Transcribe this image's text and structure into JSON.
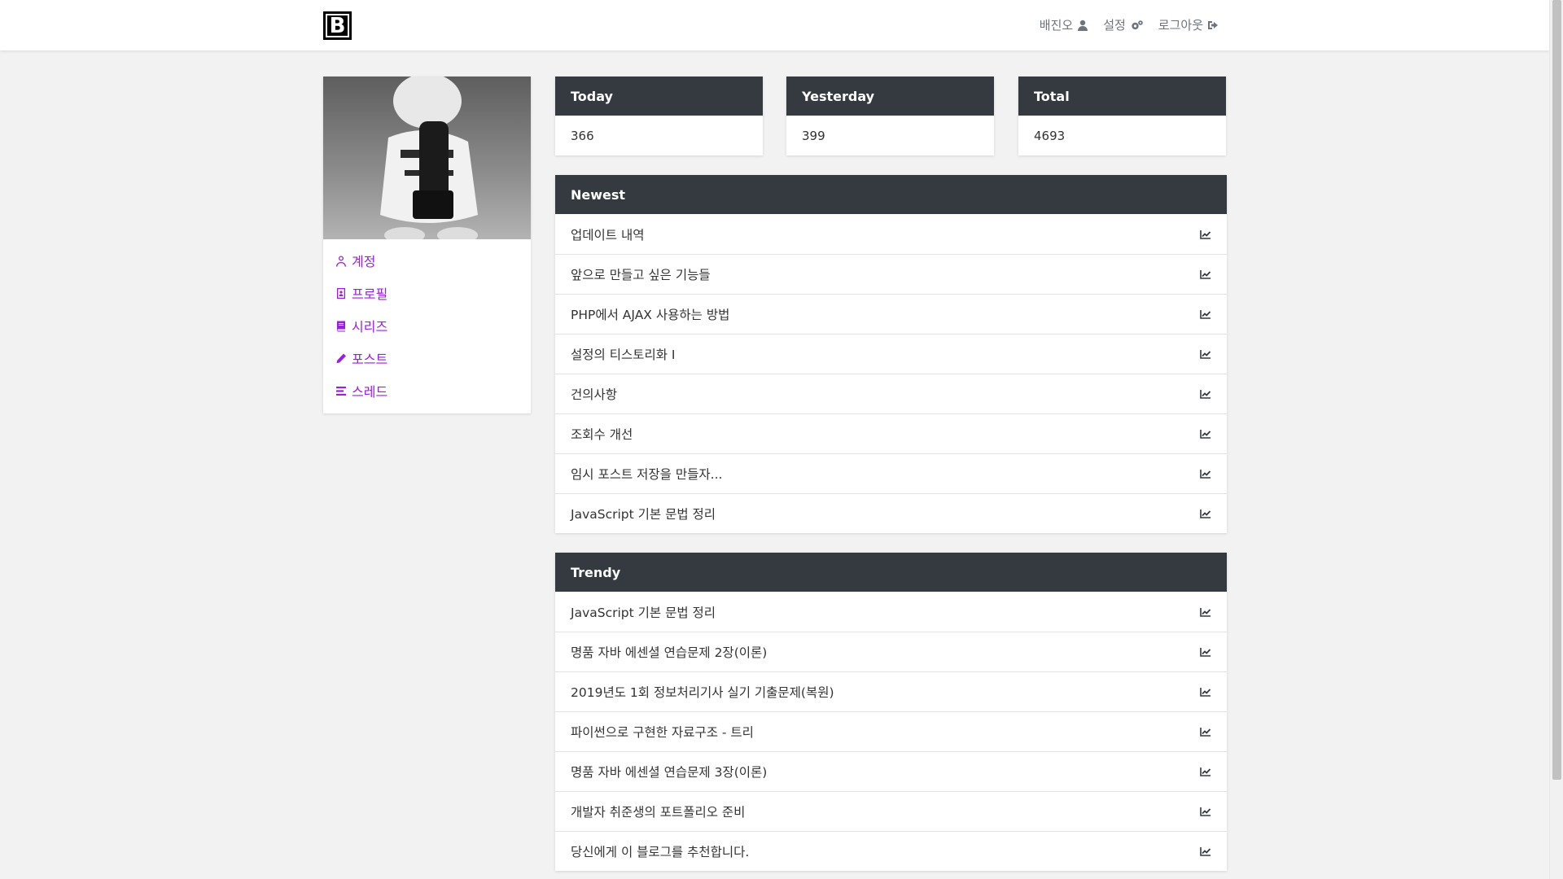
{
  "nav": {
    "brand": "B",
    "user_label": "배진오",
    "settings_label": "설정",
    "logout_label": "로그아웃"
  },
  "sidebar": {
    "items": [
      {
        "label": "계정",
        "icon": "user-outline-icon"
      },
      {
        "label": "프로필",
        "icon": "id-card-icon"
      },
      {
        "label": "시리즈",
        "icon": "book-icon"
      },
      {
        "label": "포스트",
        "icon": "pencil-icon"
      },
      {
        "label": "스레드",
        "icon": "list-icon"
      }
    ]
  },
  "stats": {
    "today": {
      "label": "Today",
      "value": "366"
    },
    "yesterday": {
      "label": "Yesterday",
      "value": "399"
    },
    "total": {
      "label": "Total",
      "value": "4693"
    }
  },
  "newest": {
    "title": "Newest",
    "items": [
      "업데이트 내역",
      "앞으로 만들고 싶은 기능들",
      "PHP에서 AJAX 사용하는 방법",
      "설정의 티스토리화 I",
      "건의사항",
      "조회수 개선",
      "임시 포스트 저장을 만들자...",
      "JavaScript 기본 문법 정리"
    ]
  },
  "trendy": {
    "title": "Trendy",
    "items": [
      "JavaScript 기본 문법 정리",
      "명품 자바 에센셜 연습문제 2장(이론)",
      "2019년도 1회 정보처리기사 실기 기출문제(복원)",
      "파이썬으로 구현한 자료구조 - 트리",
      "명품 자바 에센셜 연습문제 3장(이론)",
      "개발자 취준생의 포트폴리오 준비",
      "당신에게 이 블로그를 추천합니다."
    ]
  },
  "colors": {
    "accent": "#9b1fe0",
    "header_dark": "#343a40",
    "background": "#f2f2f2"
  }
}
